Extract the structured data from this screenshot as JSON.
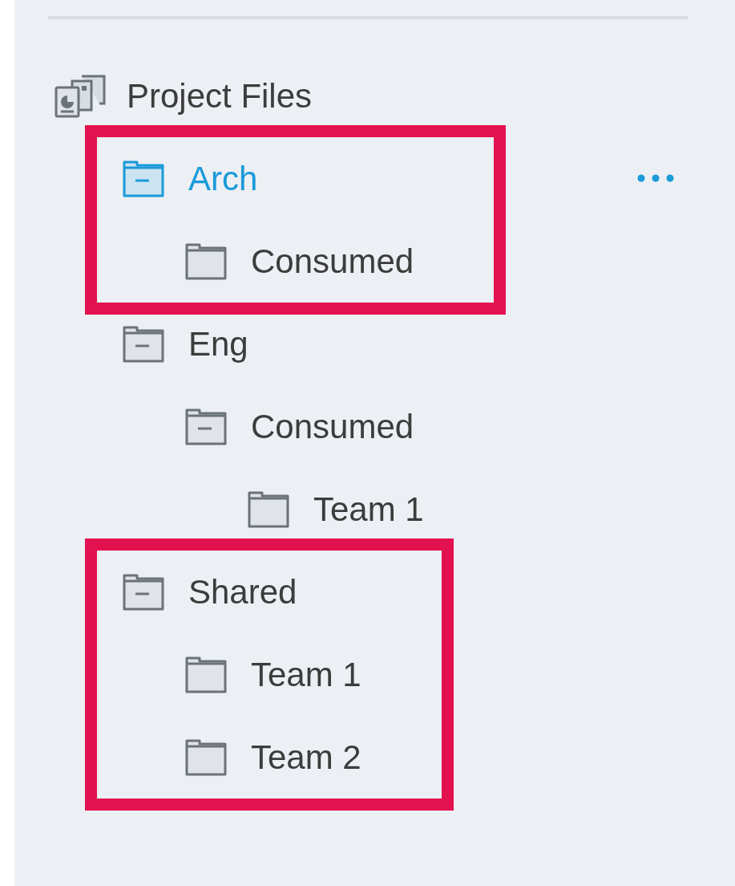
{
  "tree": [
    {
      "label": "Project Files",
      "kind": "project",
      "selected": false,
      "highlighted": false,
      "children": [
        {
          "label": "Arch",
          "kind": "folder",
          "expanded": true,
          "selected": true,
          "highlighted": true,
          "children": [
            {
              "label": "Consumed",
              "kind": "folder",
              "expanded": false,
              "selected": false,
              "highlighted": false
            }
          ]
        },
        {
          "label": "Eng",
          "kind": "folder",
          "expanded": true,
          "selected": false,
          "highlighted": false,
          "children": [
            {
              "label": "Consumed",
              "kind": "folder",
              "expanded": true,
              "selected": false,
              "highlighted": false,
              "children": [
                {
                  "label": "Team 1",
                  "kind": "folder",
                  "expanded": false,
                  "selected": false,
                  "highlighted": false
                }
              ]
            }
          ]
        },
        {
          "label": "Shared",
          "kind": "folder",
          "expanded": true,
          "selected": false,
          "highlighted": true,
          "children": [
            {
              "label": "Team 1",
              "kind": "folder",
              "expanded": false,
              "selected": false,
              "highlighted": false
            },
            {
              "label": "Team 2",
              "kind": "folder",
              "expanded": false,
              "selected": false,
              "highlighted": false
            }
          ]
        }
      ]
    }
  ]
}
